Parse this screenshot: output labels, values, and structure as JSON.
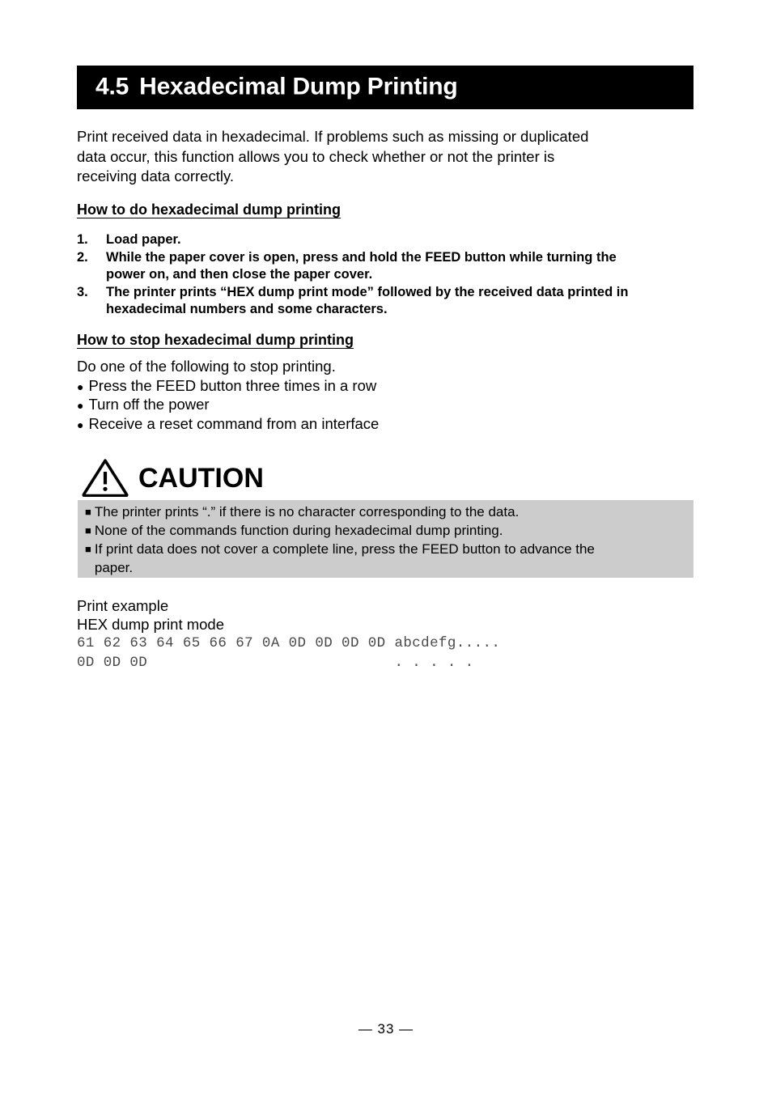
{
  "section": {
    "number": "4.5",
    "title": "Hexadecimal Dump Printing"
  },
  "intro": {
    "line1": "Print received data in hexadecimal. If problems such as missing or duplicated",
    "line2": "data occur, this function allows you to check whether or not the printer is",
    "line3": "receiving data correctly."
  },
  "how_to_do": {
    "heading": "How to do hexadecimal dump printing",
    "items": [
      {
        "marker": "1.",
        "line1": "Load paper.",
        "line2": ""
      },
      {
        "marker": "2.",
        "line1": "While the paper cover is open, press and hold the FEED button while turning the",
        "line2": "power on, and then close the paper cover."
      },
      {
        "marker": "3.",
        "line1": "The printer prints “HEX dump print mode” followed by the received data printed in",
        "line2": "hexadecimal numbers and some characters."
      }
    ]
  },
  "how_to_stop": {
    "heading": "How to stop hexadecimal dump printing",
    "lead": "Do one of the following to stop printing.",
    "bullet_glyph": "●",
    "items": [
      "Press the FEED button three times in a row",
      "Turn off the power",
      "Receive a reset command from an interface"
    ]
  },
  "caution": {
    "title": "CAUTION",
    "bullet_glyph": "■",
    "background_color": "#cccccc",
    "items": [
      {
        "line1": "The printer prints “.” if there is no character corresponding to the data.",
        "line2": ""
      },
      {
        "line1": "None of the commands function during hexadecimal dump printing.",
        "line2": ""
      },
      {
        "line1": "If print data does not cover a complete line, press the FEED button to advance the",
        "line2": "paper."
      }
    ]
  },
  "print_example": {
    "label": "Print example",
    "mode_line": "HEX dump print mode",
    "dump_line1": "61 62 63 64 65 66 67 0A 0D 0D 0D 0D abcdefg.....",
    "dump_line2": "0D 0D 0D                            . . . . ."
  },
  "footer": {
    "page_mark": "— 33 —"
  }
}
